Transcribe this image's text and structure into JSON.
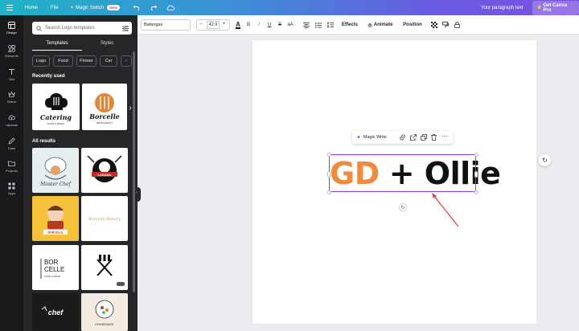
{
  "topbar": {
    "home": "Home",
    "file": "File",
    "magic_switch": "Magic Switch",
    "new_badge": "NEW",
    "doc_title": "Your paragraph text",
    "upgrade": "Get Canva Pro"
  },
  "rail": {
    "items": [
      {
        "label": "Design",
        "icon": "layout-icon"
      },
      {
        "label": "Elements",
        "icon": "shapes-icon"
      },
      {
        "label": "Text",
        "icon": "text-icon"
      },
      {
        "label": "Brand",
        "icon": "crown-icon"
      },
      {
        "label": "Uploads",
        "icon": "cloud-upload-icon"
      },
      {
        "label": "Draw",
        "icon": "pen-icon"
      },
      {
        "label": "Projects",
        "icon": "folder-icon"
      },
      {
        "label": "Apps",
        "icon": "apps-grid-icon"
      }
    ]
  },
  "panel": {
    "search_placeholder": "Search Logo templates",
    "tabs": [
      "Templates",
      "Styles"
    ],
    "chips": [
      "Logo",
      "Food",
      "Flower",
      "Car"
    ],
    "recently_used": "Recently used",
    "all_results": "All results",
    "thumb_texts": {
      "catering": "Catering",
      "catering_sub": "FOOD & DRINK",
      "borcelle": "Borcelle",
      "borcelle_sub": "RESTAURANT",
      "master_chef": "Master Chef",
      "larana": "LARANA",
      "borcelle_badge": "BORCELLE",
      "borcelle_script": "Borcelle Bakery",
      "bor": "BOR",
      "celle": "CELLE",
      "bor_sub": "FOOD & DRINK",
      "chef": "chef",
      "homemade": "HOMEMADE"
    }
  },
  "toolbar": {
    "font": "Batangas",
    "size": "42.9",
    "minus": "−",
    "plus": "+",
    "effects": "Effects",
    "animate": "Animate",
    "position": "Position"
  },
  "canvas": {
    "magic_write": "Magic Write",
    "text_part1": "GD",
    "text_part2": "+ Ollie"
  },
  "colors": {
    "accent_orange": "#f08a3e",
    "selection": "#8b3dff",
    "arrow": "#e53935"
  }
}
